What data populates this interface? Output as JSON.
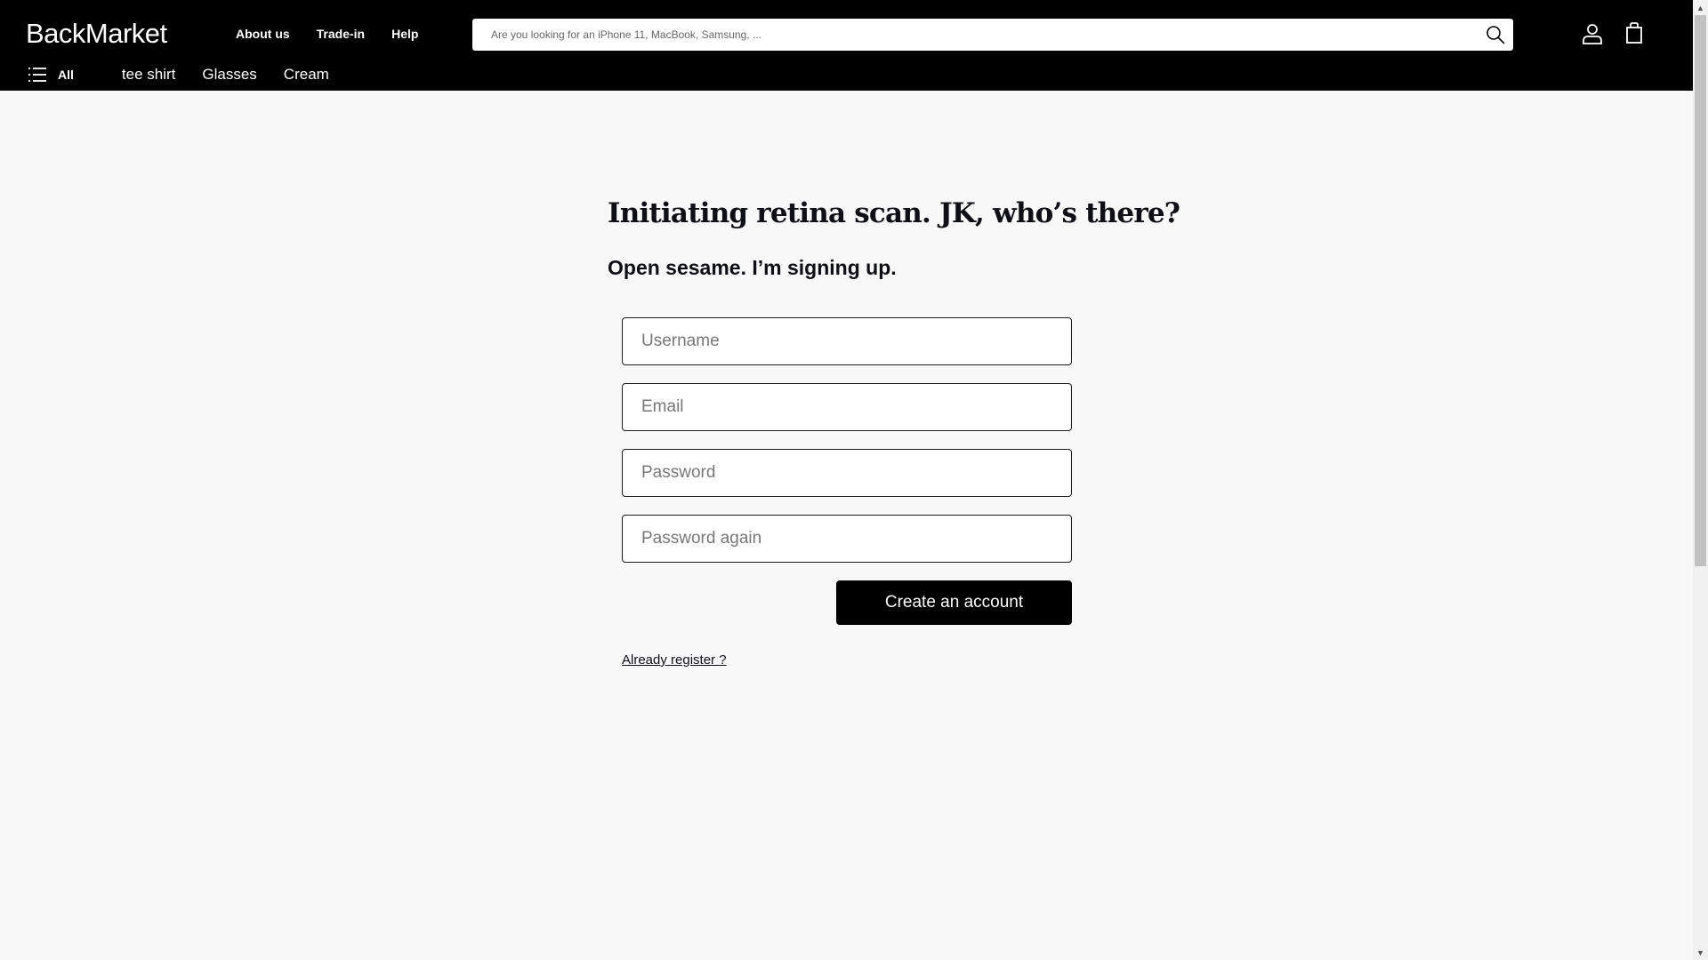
{
  "header": {
    "logo": "BackMarket",
    "nav": [
      "About us",
      "Trade-in",
      "Help"
    ],
    "search": {
      "placeholder": "Are you looking for an iPhone 11, MacBook, Samsung, ..."
    },
    "menu_label": "All",
    "categories": [
      "tee shirt",
      "Glasses",
      "Cream"
    ]
  },
  "main": {
    "title": "Initiating retina scan. JK, who’s there?",
    "subtitle": "Open sesame. I’m signing up.",
    "fields": {
      "username": {
        "placeholder": "Username",
        "value": ""
      },
      "email": {
        "placeholder": "Email",
        "value": ""
      },
      "password": {
        "placeholder": "Password",
        "value": ""
      },
      "password_again": {
        "placeholder": "Password again",
        "value": ""
      }
    },
    "submit_label": "Create an account",
    "login_link": "Already register ?"
  },
  "colors": {
    "header_bg": "#000000",
    "page_bg": "#f8f8f8",
    "button_bg": "#000000"
  },
  "icons": [
    "search-icon",
    "account-icon",
    "cart-icon",
    "menu-icon"
  ]
}
